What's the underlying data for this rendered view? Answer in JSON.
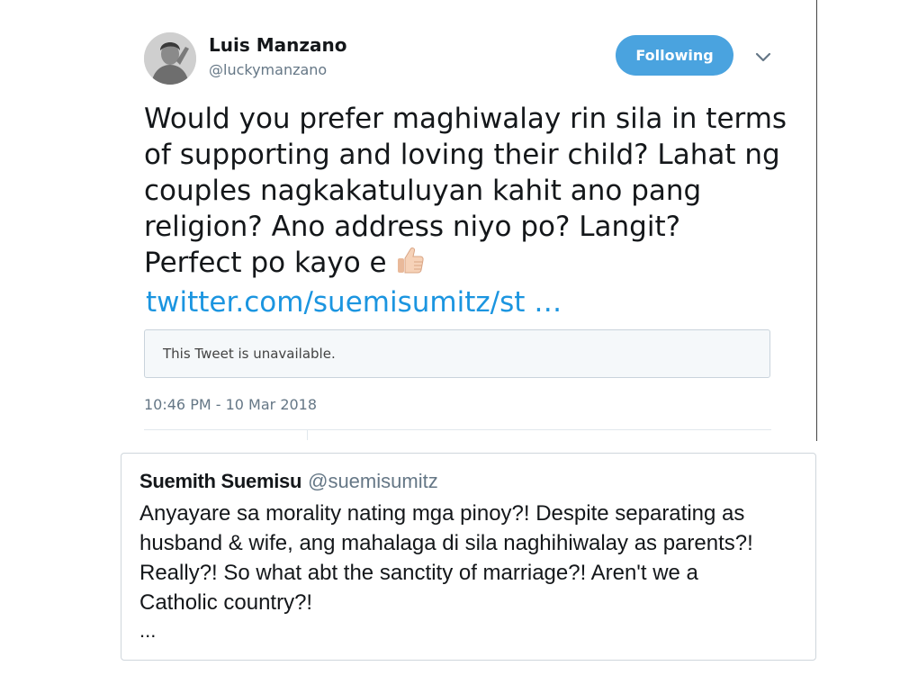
{
  "tweet": {
    "author": {
      "display_name": "Luis Manzano",
      "handle": "@luckymanzano"
    },
    "follow_button_label": "Following",
    "menu_icon": "chevron-down-icon",
    "text_lines": [
      "Would you prefer maghiwalay rin sila in terms",
      "of supporting and loving their child? Lahat ng",
      "couples nagkakatuluyan kahit ano pang",
      "religion? Ano address niyo po? Langit?",
      "Perfect po kayo e"
    ],
    "emoji_icon": "thumbs-up-icon",
    "link_text": "twitter.com/suemisumitz/st …",
    "quote_unavailable_text": "This Tweet is unavailable.",
    "timestamp": "10:46 PM - 10 Mar 2018",
    "colors": {
      "accent": "#4aa3df",
      "link": "#1b95e0",
      "muted": "#657786"
    }
  },
  "quoted": {
    "display_name": "Suemith Suemisu",
    "handle": "@suemisumitz",
    "text_lines": [
      "Anyayare sa morality nating mga pinoy?! Despite separating as",
      "husband & wife, ang mahalaga di sila naghihiwalay as parents?!",
      "Really?! So what abt the sanctity of marriage?! Aren't we a",
      "Catholic country?!"
    ],
    "ellipsis": "..."
  }
}
